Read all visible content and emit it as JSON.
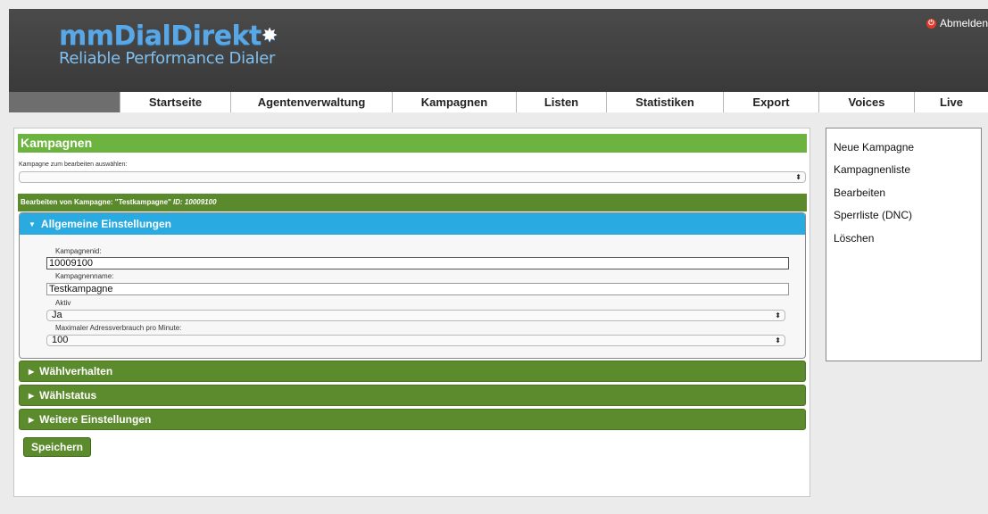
{
  "header": {
    "logo_main": "mmDialDirekt",
    "logo_sub": "Reliable Performance Dialer",
    "logout_label": "Abmelden"
  },
  "nav": {
    "items": [
      "Startseite",
      "Agentenverwaltung",
      "Kampagnen",
      "Listen",
      "Statistiken",
      "Export",
      "Voices",
      "Live"
    ]
  },
  "main": {
    "title": "Kampagnen",
    "select_label": "Kampagne zum bearbeiten auswählen:",
    "select_value": "",
    "edit_prefix": "Bearbeiten von Kampagne: \"Testkampagne\"",
    "edit_id": "ID: 10009100",
    "general": {
      "heading": "Allgemeine Einstellungen",
      "id_label": "Kampagnenid:",
      "id_value": "10009100",
      "name_label": "Kampagnenname:",
      "name_value": "Testkampagne",
      "active_label": "Aktiv",
      "active_value": "Ja",
      "rate_label": "Maximaler Adressverbrauch pro Minute:",
      "rate_value": "100"
    },
    "sections": [
      "Wählverhalten",
      "Wählstatus",
      "Weitere Einstellungen"
    ],
    "save_label": "Speichern"
  },
  "sidebar": {
    "items": [
      "Neue Kampagne",
      "Kampagnenliste",
      "Bearbeiten",
      "Sperrliste (DNC)",
      "Löschen"
    ]
  },
  "colors": {
    "header_bg": "#404040",
    "green_title": "#6db33f",
    "green_dark": "#5b8b2d",
    "blue_section": "#29abe2"
  },
  "icons": {
    "logout": "power-icon",
    "select_arrow": "updown-arrow-icon",
    "caret_open": "triangle-down-icon",
    "caret_closed": "triangle-right-icon"
  }
}
